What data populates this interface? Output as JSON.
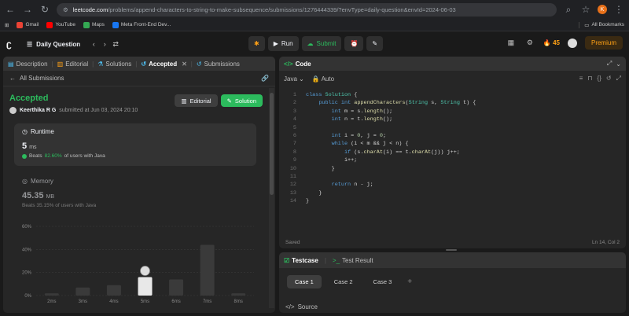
{
  "browser": {
    "url_host": "leetcode.com",
    "url_path": "/problems/append-characters-to-string-to-make-subsequence/submissions/1276444339/?envType=daily-question&envId=2024-06-03",
    "bookmarks": [
      {
        "label": "Gmail",
        "color": "#ea4335"
      },
      {
        "label": "YouTube",
        "color": "#ff0000"
      },
      {
        "label": "Maps",
        "color": "#34a853"
      },
      {
        "label": "Meta Front-End Dev...",
        "color": "#1877f2"
      }
    ],
    "all_bookmarks": "All Bookmarks",
    "profile_initial": "K"
  },
  "appbar": {
    "problem_list": "Daily Question",
    "run": "Run",
    "submit": "Submit",
    "streak": "45",
    "premium": "Premium"
  },
  "left_tabs": [
    {
      "label": "Description"
    },
    {
      "label": "Editorial"
    },
    {
      "label": "Solutions"
    },
    {
      "label": "Accepted"
    },
    {
      "label": "Submissions"
    }
  ],
  "submission": {
    "back_label": "All Submissions",
    "status": "Accepted",
    "user": "Keerthika R G",
    "submitted_text": "submitted at Jun 03, 2024 20:10",
    "editorial_btn": "Editorial",
    "solution_btn": "Solution",
    "runtime": {
      "title": "Runtime",
      "value": "5",
      "unit": "ms",
      "beats_prefix": "Beats",
      "beats_pct": "82.60%",
      "beats_suffix": "of users with Java"
    },
    "memory": {
      "title": "Memory",
      "value": "45.35",
      "unit": "MB",
      "beats": "Beats 35.15% of users with Java"
    }
  },
  "chart_data": {
    "type": "bar",
    "categories": [
      "2ms",
      "3ms",
      "4ms",
      "5ms",
      "6ms",
      "7ms",
      "8ms"
    ],
    "values": [
      2,
      7,
      9,
      16,
      14,
      44,
      2
    ],
    "yticks": [
      "0%",
      "20%",
      "40%",
      "60%"
    ],
    "ylim": [
      0,
      60
    ],
    "highlight_index": 3,
    "bar_color": "#3a3a3a",
    "highlight_color": "#e8e8e8"
  },
  "editor": {
    "title": "Code",
    "language": "Java",
    "mode": "Auto",
    "code_lines": [
      "class Solution {",
      "    public int appendCharacters(String s, String t) {",
      "        int m = s.length();",
      "        int n = t.length();",
      "",
      "        int i = 0, j = 0;",
      "        while (i < m && j < n) {",
      "            if (s.charAt(i) == t.charAt(j)) j++;",
      "            i++;",
      "        }",
      "",
      "        return n - j;",
      "    }",
      "}"
    ],
    "saved": "Saved",
    "cursor": "Ln 14, Col 2"
  },
  "testcase": {
    "tab_testcase": "Testcase",
    "tab_result": "Test Result",
    "cases": [
      "Case 1",
      "Case 2",
      "Case 3"
    ],
    "source": "Source"
  }
}
